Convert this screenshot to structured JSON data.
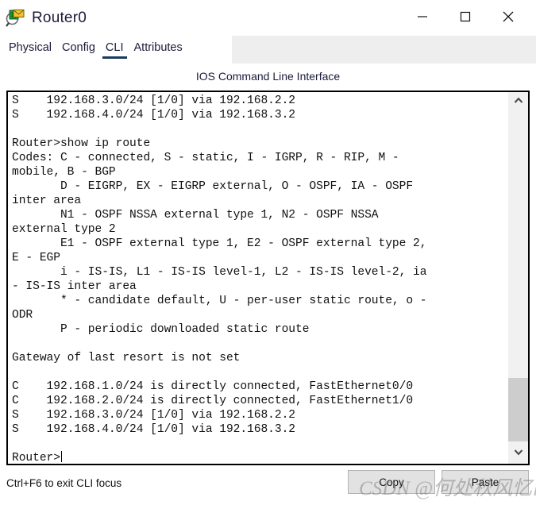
{
  "window": {
    "title": "Router0",
    "icon": "router-device-icon",
    "controls": [
      {
        "name": "minimize",
        "glyph": "minimize-icon"
      },
      {
        "name": "maximize",
        "glyph": "maximize-icon"
      },
      {
        "name": "close",
        "glyph": "close-icon"
      }
    ]
  },
  "tabs": [
    {
      "label": "Physical",
      "active": false
    },
    {
      "label": "Config",
      "active": false
    },
    {
      "label": "CLI",
      "active": true
    },
    {
      "label": "Attributes",
      "active": false
    }
  ],
  "panel": {
    "header": "IOS Command Line Interface"
  },
  "terminal": {
    "text": "S    192.168.3.0/24 [1/0] via 192.168.2.2\nS    192.168.4.0/24 [1/0] via 192.168.3.2\n\nRouter>show ip route\nCodes: C - connected, S - static, I - IGRP, R - RIP, M -\nmobile, B - BGP\n       D - EIGRP, EX - EIGRP external, O - OSPF, IA - OSPF\ninter area\n       N1 - OSPF NSSA external type 1, N2 - OSPF NSSA\nexternal type 2\n       E1 - OSPF external type 1, E2 - OSPF external type 2,\nE - EGP\n       i - IS-IS, L1 - IS-IS level-1, L2 - IS-IS level-2, ia\n- IS-IS inter area\n       * - candidate default, U - per-user static route, o -\nODR\n       P - periodic downloaded static route\n\nGateway of last resort is not set\n\nC    192.168.1.0/24 is directly connected, FastEthernet0/0\nC    192.168.2.0/24 is directly connected, FastEthernet1/0\nS    192.168.3.0/24 [1/0] via 192.168.2.2\nS    192.168.4.0/24 [1/0] via 192.168.3.2\n\n",
    "prompt": "Router>",
    "scrollbar": {
      "up_icon": "chevron-up-icon",
      "down_icon": "chevron-down-icon",
      "thumb_top_pct": 77,
      "thumb_height_pct": 17
    }
  },
  "footer": {
    "hint": "Ctrl+F6 to exit CLI focus",
    "copy_label": "Copy",
    "paste_label": "Paste"
  },
  "watermark": {
    "text": "CSDN @何处秋风忆画扇"
  },
  "colors": {
    "accent": "#1b3a5c",
    "tab_strip": "#eeeeee",
    "terminal_border": "#000000",
    "scrollbar_thumb": "#cdcdcd",
    "button_face": "#e2e2e2"
  }
}
